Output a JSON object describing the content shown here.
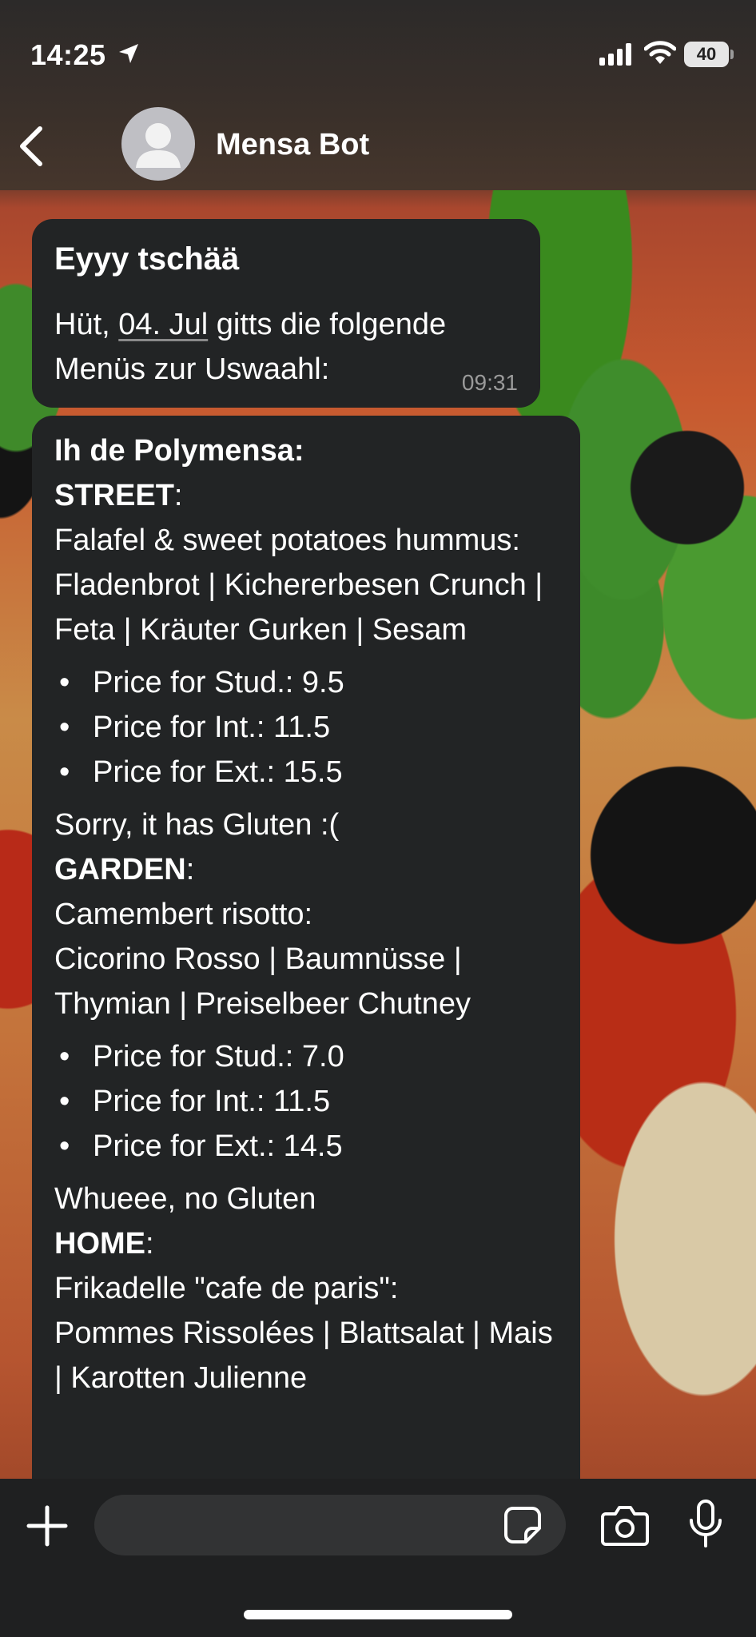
{
  "status_bar": {
    "time": "14:25",
    "battery": "40"
  },
  "header": {
    "title": "Mensa Bot"
  },
  "messages": {
    "m1": {
      "greeting": "Eyyy tschää",
      "text_prefix": "Hüt, ",
      "date_link": "04. Jul",
      "text_suffix": " gitts die folgende Menüs zur Uswaahl:",
      "time": "09:31"
    },
    "m2": {
      "heading": "Ih de Polymensa:",
      "street": {
        "label": "STREET",
        "colon": ":",
        "dish": "Falafel & sweet potatoes hummus:",
        "ingredients": "Fladenbrot | Kichererbesen Crunch | Feta | Kräuter Gurken | Sesam",
        "prices": [
          "Price for Stud.: 9.5",
          "Price for Int.: 11.5",
          "Price for Ext.: 15.5"
        ],
        "gluten_note": "Sorry, it has Gluten :("
      },
      "garden": {
        "label": "GARDEN",
        "colon": ":",
        "dish": "Camembert risotto:",
        "ingredients": "Cicorino Rosso | Baumnüsse | Thymian | Preiselbeer Chutney",
        "prices": [
          "Price for Stud.: 7.0",
          "Price for Int.: 11.5",
          "Price for Ext.: 14.5"
        ],
        "gluten_note": "Whueee, no Gluten"
      },
      "home": {
        "label": "HOME",
        "colon": ":",
        "dish": "Frikadelle \"cafe de paris\":",
        "ingredients": "Pommes Rissolées | Blattsalat | Mais | Karotten Julienne"
      }
    }
  },
  "composer": {
    "placeholder": ""
  },
  "icons": {
    "location": "location-arrow-icon",
    "signal": "signal-icon",
    "wifi": "wifi-icon",
    "back": "chevron-left-icon",
    "avatar": "person-icon",
    "plus": "plus-icon",
    "sticker": "sticker-icon",
    "camera": "camera-icon",
    "mic": "microphone-icon"
  },
  "colors": {
    "bubble": "#222425",
    "bottom_bar": "#1f2021",
    "input": "#323334"
  }
}
